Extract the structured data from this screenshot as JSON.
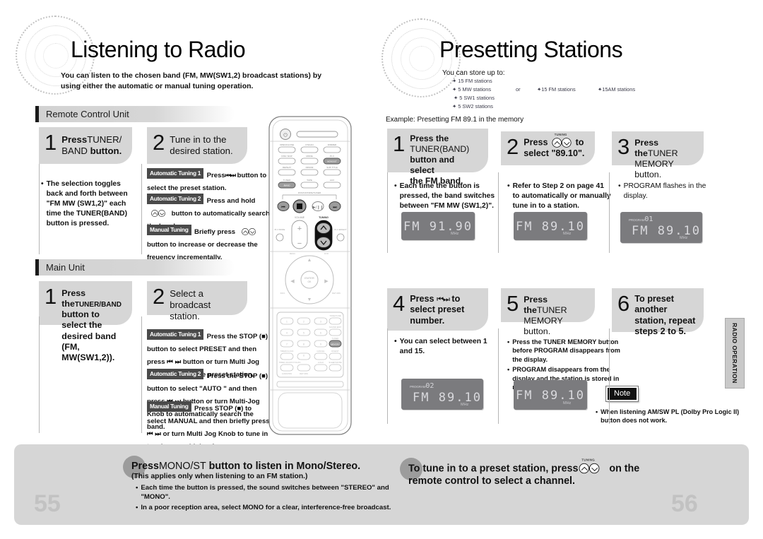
{
  "left_page": {
    "title": "Listening to Radio",
    "subtitle": "You can listen to the chosen band (FM, MW(SW1,2) broadcast stations) by using either the automatic or manual tuning operation.",
    "sections": [
      {
        "label": "Remote Control Unit"
      },
      {
        "label": "Main Unit"
      }
    ],
    "remote_steps": [
      {
        "num": "1",
        "bold1": "Press",
        "normal1": "TUNER/",
        "line2_normal": "BAND",
        "line2_bold": "button."
      },
      {
        "num": "2",
        "text": "Tune in to the desired station."
      }
    ],
    "remote_bullet": "The selection toggles back and forth between \"FM      MW (SW1,2)\" each time the TUNER(BAND) button is pressed.",
    "remote_tuning": [
      {
        "chip": "Automatic Tuning 1",
        "text_a": "Press",
        "text_b": "button to select the preset station."
      },
      {
        "chip": "Automatic Tuning 2",
        "text_a": "Press and hold",
        "text_b": "button to automatically search the band."
      },
      {
        "chip": "Manual Tuning",
        "text_a": "Briefly press",
        "text_b": "button to increase or decrease the freuency incrementally."
      }
    ],
    "main_steps": [
      {
        "num": "1",
        "text_bold": "Press the",
        "text_small": "TUNER/BAND",
        "text_rest": "button to select the desired band (FM, MW(SW1,2))."
      },
      {
        "num": "2",
        "text": "Select a broadcast station."
      }
    ],
    "main_tuning": [
      {
        "chip": "Automatic Tuning 1",
        "text": "Press the STOP (■) button to select PRESET and then press ⏮ ⏭ button or turn Multi Jog Knob to select the preset station."
      },
      {
        "chip": "Automatic Tuning 2",
        "text": "Press the STOP (■) button to select \"AUTO \" and then press ⏮ ⏭ button or turn Multi-Jog Knob to automatically search the band."
      },
      {
        "chip": "Manual Tuning",
        "text": "Press STOP (■) to select MANUAL and then briefly press ⏮ ⏭ or turn Multi Jog Knob to tune in to a lower or higher freuency."
      }
    ],
    "page_number": "55"
  },
  "right_page": {
    "title": "Presetting Stations",
    "subtitle": "You can store up to:",
    "store_list_left": [
      "15 FM stations",
      "5 MW stations",
      "5 SW1 stations",
      "5 SW2 stations"
    ],
    "store_or": "or",
    "store_list_right": [
      "15 FM stations",
      "15AM stations"
    ],
    "example": "Example: Presetting FM 89.1 in the memory",
    "steps": [
      {
        "num": "1",
        "title_lines": [
          "Press the",
          "TUNER(BAND)",
          "button  and select",
          "the FM band."
        ],
        "bullets": [
          "Each time the button is pressed, the band switches between \"FM      MW   (SW1,2)\"."
        ],
        "lcd": {
          "program": "",
          "freq": "FM  91.90",
          "unit": "MHz"
        }
      },
      {
        "num": "2",
        "title_pre": "Press",
        "title_post": "to",
        "title_line2": "select \"89.10\".",
        "tuning_label": "TUNING",
        "bullets": [
          "Refer to Step 2 on page 41 to automatically or manually tune in to a station."
        ],
        "lcd": {
          "program": "",
          "freq": "FM  89.10",
          "unit": "MHz"
        }
      },
      {
        "num": "3",
        "title_bold": "Press the",
        "title_small": "TUNER",
        "title_line2": "MEMORY button.",
        "bullets": [
          "PROGRAM  flashes in the display."
        ],
        "lcd": {
          "program_label": "PROGRAM",
          "program": "01",
          "freq": "FM  89.10",
          "unit": "MHz"
        }
      },
      {
        "num": "4",
        "title_pre": "Press",
        "title_post": "to",
        "title_line2": "select preset",
        "title_line3": "number.",
        "bullets": [
          "You can select between 1 and 15."
        ],
        "lcd": {
          "program_label": "PROGRAM",
          "program": "02",
          "freq": "FM  89.10",
          "unit": "MHz"
        }
      },
      {
        "num": "5",
        "title_bold": "Press the",
        "title_small": "TUNER",
        "title_line2": "MEMORY button.",
        "bullets": [
          "Press the TUNER MEMORY button before PROGRAM  disappears from the display.",
          "PROGRAM  disappears from the display and the station is stored in memory."
        ],
        "lcd": {
          "program": "",
          "freq": "FM  89.10",
          "unit": "MHz"
        }
      },
      {
        "num": "6",
        "title_lines": [
          "To preset another",
          "station, repeat",
          "steps 2 to 5."
        ],
        "bullets": []
      }
    ],
    "note": {
      "badge": "Note",
      "text": "When listening AM/SW    PL      (Dolby Pro Logic II) button does not work."
    },
    "page_number": "56"
  },
  "bottom_panel": {
    "left_tip": {
      "bold_lead": "Press",
      "normal": "MONO/ST",
      "bold_rest": "button to listen in Mono/Stereo.",
      "sub": "(This applies only when listening to an FM station.)",
      "bullets": [
        "Each time the button is pressed, the sound switches between \"STEREO\" and \"MONO\".",
        "In a poor reception area, select MONO for a clear, interference-free broadcast."
      ]
    },
    "right_tip": {
      "line1_pre": "To tune in to a preset station, press",
      "tuning_label": "TUNING",
      "line1_post": "on the",
      "line2": "remote control to select a channel."
    }
  },
  "side_tab": {
    "label": "RADIO OPERATION"
  },
  "icons": {
    "skip_back": "skip-back-icon",
    "skip_fwd": "skip-forward-icon",
    "tuning_up": "tuning-up-icon",
    "tuning_down": "tuning-down-icon",
    "stop": "stop-icon"
  },
  "colors": {
    "panel_grey": "#d6d6d6",
    "chip_dark": "#4a4a4a",
    "lcd_bg": "#7b7b7e",
    "lcd_text": "#d9d9dd",
    "page_num": "#c2c2c2"
  }
}
